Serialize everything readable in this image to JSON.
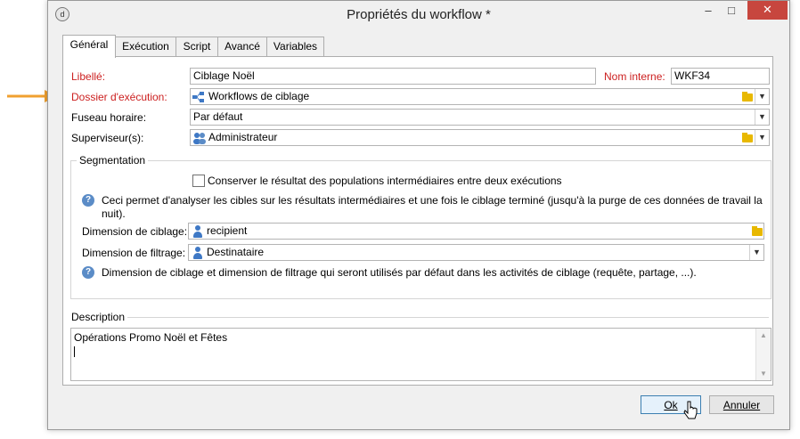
{
  "window": {
    "title": "Propriétés du workflow *",
    "controls": {
      "minimize": "–",
      "maximize": "□",
      "close": "✕"
    }
  },
  "tabs": [
    {
      "label": "Général",
      "active": true
    },
    {
      "label": "Exécution",
      "active": false
    },
    {
      "label": "Script",
      "active": false
    },
    {
      "label": "Avancé",
      "active": false
    },
    {
      "label": "Variables",
      "active": false
    }
  ],
  "general": {
    "libelle_label": "Libellé:",
    "libelle_value": "Ciblage Noël",
    "nom_interne_label": "Nom interne:",
    "nom_interne_value": "WKF34",
    "dossier_label": "Dossier d'exécution:",
    "dossier_value": "Workflows de ciblage",
    "fuseau_label": "Fuseau horaire:",
    "fuseau_value": "Par défaut",
    "superviseur_label": "Superviseur(s):",
    "superviseur_value": "Administrateur"
  },
  "segmentation": {
    "title": "Segmentation",
    "checkbox_label": "Conserver le résultat des populations intermédiaires entre deux exécutions",
    "checkbox_checked": false,
    "info1_line1": "Ceci permet d'analyser les cibles sur les résultats intermédiaires et une fois le ciblage terminé (jusqu'à la purge de ces données de travail la",
    "info1_line2": "nuit).",
    "ciblage_label": "Dimension de ciblage:",
    "ciblage_value": "recipient",
    "filtrage_label": "Dimension de filtrage:",
    "filtrage_value": "Destinataire",
    "info2": "Dimension de ciblage et dimension de filtrage qui seront utilisés par défaut dans les activités de ciblage (requête, partage, ...)."
  },
  "description": {
    "title": "Description",
    "value": "Opérations Promo Noël et Fêtes"
  },
  "buttons": {
    "ok_label": "Ok",
    "cancel_label": "Annuler"
  },
  "colors": {
    "required_label": "#cc1f1f",
    "callout_arrow": "#f0a030",
    "close_button": "#c7463e"
  }
}
